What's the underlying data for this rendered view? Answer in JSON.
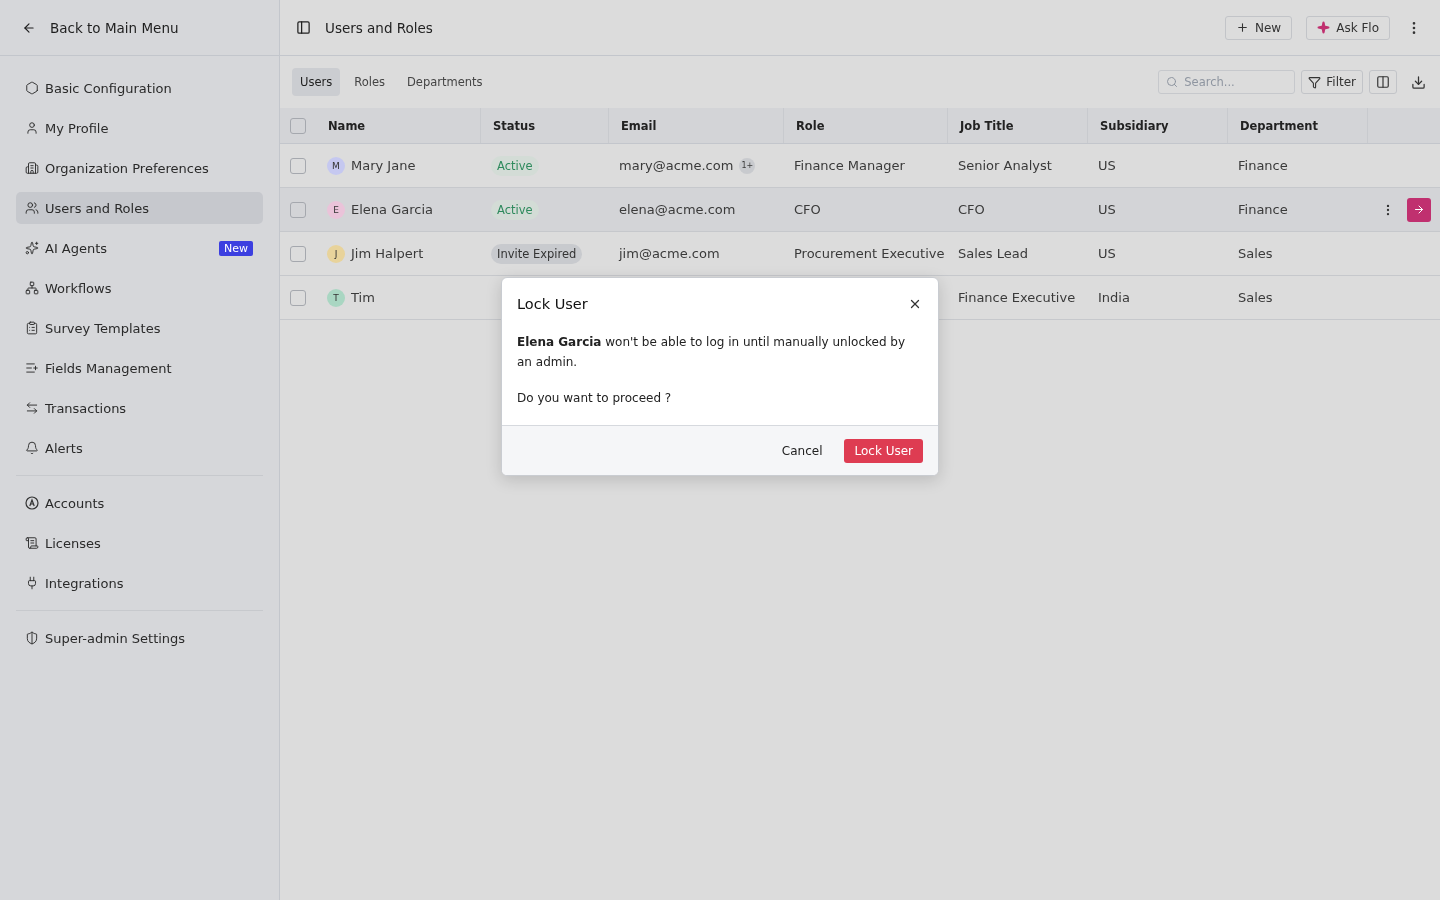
{
  "back_link": "Back to Main Menu",
  "sidebar": {
    "sections": [
      [
        {
          "label": "Basic Configuration",
          "selected": false
        },
        {
          "label": "My Profile",
          "selected": false
        },
        {
          "label": "Organization Preferences",
          "selected": false
        },
        {
          "label": "Users and Roles",
          "selected": true
        },
        {
          "label": "AI Agents",
          "selected": false,
          "badge": "New"
        },
        {
          "label": "Workflows",
          "selected": false
        },
        {
          "label": "Survey Templates",
          "selected": false
        },
        {
          "label": "Fields Management",
          "selected": false
        },
        {
          "label": "Transactions",
          "selected": false
        },
        {
          "label": "Alerts",
          "selected": false
        }
      ],
      [
        {
          "label": "Accounts",
          "selected": false
        },
        {
          "label": "Licenses",
          "selected": false
        },
        {
          "label": "Integrations",
          "selected": false
        }
      ],
      [
        {
          "label": "Super-admin Settings",
          "selected": false
        }
      ]
    ]
  },
  "header": {
    "title": "Users and Roles",
    "buttons": [
      {
        "label": "New",
        "kind": "plus"
      },
      {
        "label": "Ask Flo",
        "kind": "sparkle"
      }
    ]
  },
  "tabs": [
    {
      "label": "Users",
      "selected": true
    },
    {
      "label": "Roles",
      "selected": false
    },
    {
      "label": "Departments",
      "selected": false
    }
  ],
  "search": {
    "placeholder": "Search..."
  },
  "filter_button": "Filter",
  "table": {
    "select_all_checked": false,
    "columns": [
      "Name",
      "Status",
      "Email",
      "Role",
      "Job Title",
      "Subsidiary",
      "Department"
    ],
    "rows": [
      {
        "initial": "M",
        "color": "#c5c8f0",
        "name": "Mary Jane",
        "status": {
          "label": "Active",
          "kind": "active"
        },
        "email": "mary@acme.com",
        "email_extra": "1+",
        "role": "Finance Manager",
        "job_title": "Senior Analyst",
        "subsidiary": "US",
        "department": "Finance",
        "checked": false,
        "hovered": false
      },
      {
        "initial": "E",
        "color": "#eac3d9",
        "name": "Elena Garcia",
        "status": {
          "label": "Active",
          "kind": "active"
        },
        "email": "elena@acme.com",
        "role": "CFO",
        "job_title": "CFO",
        "subsidiary": "US",
        "department": "Finance",
        "checked": false,
        "hovered": true
      },
      {
        "initial": "J",
        "color": "#e8d39b",
        "name": "Jim Halpert",
        "status": {
          "label": "Invite Expired",
          "kind": "expired"
        },
        "email": "jim@acme.com",
        "role": "Procurement Executive",
        "job_title": "Sales Lead",
        "subsidiary": "US",
        "department": "Sales",
        "checked": false,
        "hovered": false
      },
      {
        "initial": "T",
        "color": "#a9d6c2",
        "name": "Tim",
        "job_title": "Finance Executive",
        "subsidiary": "India",
        "department": "Sales",
        "checked": false,
        "hovered": false
      }
    ]
  },
  "dialog": {
    "title": "Lock User",
    "message": "**Elena Garcia** won't be able to log in until manually unlocked by an admin.",
    "question": "Do you want to proceed ?",
    "cancel": "Cancel",
    "confirm": "Lock User"
  }
}
